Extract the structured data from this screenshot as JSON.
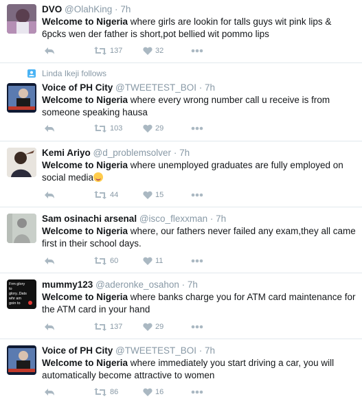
{
  "tweets": [
    {
      "name": "DVO",
      "handle": "@OlahKing",
      "time": "7h",
      "keyword": "Welcome to Nigeria",
      "text": " where girls are lookin for talls guys wit pink lips & 6pcks wen der father is short,pot bellied wit pommo lips",
      "retweets": "137",
      "likes": "32",
      "avatar_color": "#8a6d8a"
    },
    {
      "context": "Linda Ikeji follows",
      "name": "Voice of PH City",
      "handle": "@TWEETEST_BOI",
      "time": "7h",
      "keyword": "Welcome to Nigeria",
      "text": " where every wrong number call u receive is from someone speaking hausa",
      "retweets": "103",
      "likes": "29",
      "avatar_color": "#1b2b4b"
    },
    {
      "name": "Kemi Ariyo",
      "handle": "@d_problemsolver",
      "time": "7h",
      "keyword": "Welcome to Nigeria",
      "text": " where unemployed graduates are fully employed on social media",
      "emoji": "smile",
      "retweets": "44",
      "likes": "15",
      "avatar_color": "#5b4a3f"
    },
    {
      "name": "Sam osinachi arsenal",
      "handle": "@isco_flexxman",
      "time": "7h",
      "keyword": "Welcome to Nigeria",
      "text": " where, our fathers  never failed any exam,they all came first in their school days.",
      "retweets": "60",
      "likes": "11",
      "avatar_color": "#9aa39a"
    },
    {
      "name": "mummy123",
      "handle": "@aderonke_osahon",
      "time": "7h",
      "keyword": "Welcome to Nigeria",
      "text": " where banks charge you for ATM card maintenance for the ATM card in your hand",
      "retweets": "137",
      "likes": "29",
      "avatar_color": "#111111",
      "avatar_text": "Frm glory to glory..Dats whr am goin to"
    },
    {
      "name": "Voice of PH City",
      "handle": "@TWEETEST_BOI",
      "time": "7h",
      "keyword": "Welcome to Nigeria",
      "text": " where immediately you start driving a car, you will automatically become attractive to women",
      "retweets": "86",
      "likes": "16",
      "avatar_color": "#1b2b4b"
    }
  ],
  "colors": {
    "text": "#14171a",
    "muted": "#8899a6",
    "icon": "#aab8c2",
    "divider": "#e1e8ed",
    "follow_icon": "#4ab3f4"
  },
  "icons": [
    "reply-icon",
    "retweet-icon",
    "heart-icon",
    "more-icon",
    "follow-person-icon"
  ]
}
